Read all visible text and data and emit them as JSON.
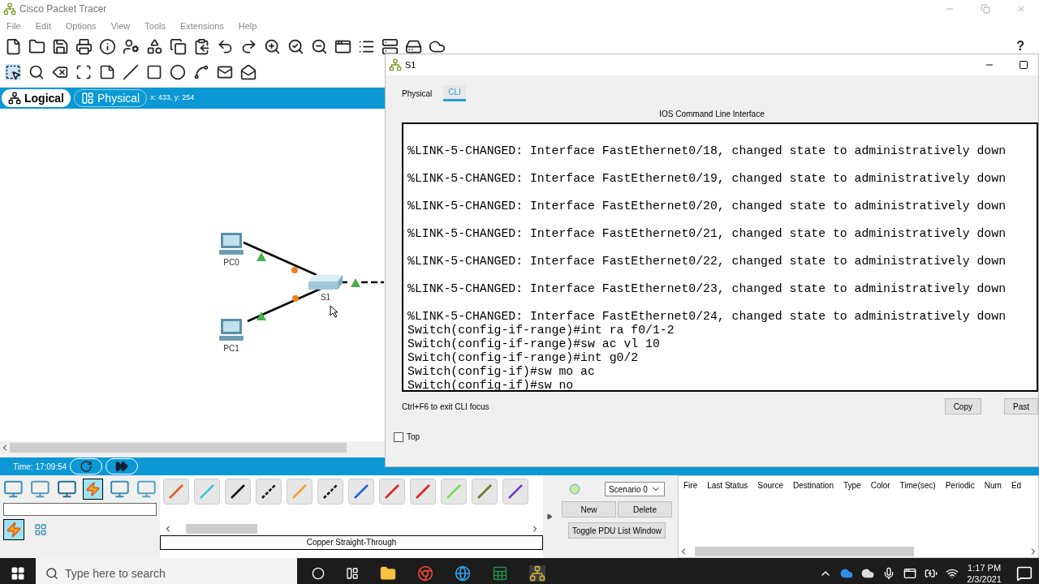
{
  "app": {
    "title": "Cisco Packet Tracer",
    "menu": [
      "File",
      "Edit",
      "Options",
      "View",
      "Tools",
      "Extensions",
      "Help"
    ],
    "help": "?"
  },
  "workspace_tabs": [
    {
      "label": "Logical",
      "selected": true
    },
    {
      "label": "Physical",
      "selected": false
    }
  ],
  "coordinates": "x: 433, y: 254",
  "topology": {
    "devices": [
      {
        "label": "PC0",
        "kind": "pc"
      },
      {
        "label": "PC1",
        "kind": "pc"
      },
      {
        "label": "S1",
        "kind": "switch"
      }
    ]
  },
  "time": "Time: 17:09:54",
  "cable_caption": "Copper Straight-Through",
  "pdu": {
    "scenario": "Scenario 0",
    "buttons": [
      "New",
      "Delete"
    ],
    "toggle": "Toggle PDU List Window",
    "columns": [
      "Fire",
      "Last Status",
      "Source",
      "Destination",
      "Type",
      "Color",
      "Time(sec)",
      "Periodic",
      "Num",
      "Ed"
    ]
  },
  "taskbar": {
    "search_placeholder": "Type here to search",
    "time": "1:17 PM",
    "date": "2/3/2021"
  },
  "device_window": {
    "title": "S1",
    "tabs": [
      {
        "label": "Physical",
        "selected": false
      },
      {
        "label": "CLI",
        "selected": true
      }
    ],
    "heading": "IOS Command Line Interface",
    "lines": [
      {
        "kind": "log",
        "text": "%LINK-5-CHANGED: Interface FastEthernet0/18, changed state to administratively down"
      },
      {
        "kind": "log",
        "text": "%LINK-5-CHANGED: Interface FastEthernet0/19, changed state to administratively down"
      },
      {
        "kind": "log",
        "text": "%LINK-5-CHANGED: Interface FastEthernet0/20, changed state to administratively down"
      },
      {
        "kind": "log",
        "text": "%LINK-5-CHANGED: Interface FastEthernet0/21, changed state to administratively down"
      },
      {
        "kind": "log",
        "text": "%LINK-5-CHANGED: Interface FastEthernet0/22, changed state to administratively down"
      },
      {
        "kind": "log",
        "text": "%LINK-5-CHANGED: Interface FastEthernet0/23, changed state to administratively down"
      },
      {
        "kind": "log",
        "text": "%LINK-5-CHANGED: Interface FastEthernet0/24, changed state to administratively down"
      },
      {
        "kind": "command",
        "text": "Switch(config-if-range)#int ra f0/1-2"
      },
      {
        "kind": "command",
        "text": "Switch(config-if-range)#sw ac vl 10"
      },
      {
        "kind": "command",
        "text": "Switch(config-if-range)#int g0/2"
      },
      {
        "kind": "command",
        "text": "Switch(config-if)#sw mo ac"
      },
      {
        "kind": "command",
        "text": "Switch(config-if)#sw no"
      }
    ],
    "hint": "Ctrl+F6 to exit CLI focus",
    "buttons": [
      "Copy",
      "Past"
    ],
    "top": {
      "label": "Top",
      "checked": false
    }
  }
}
